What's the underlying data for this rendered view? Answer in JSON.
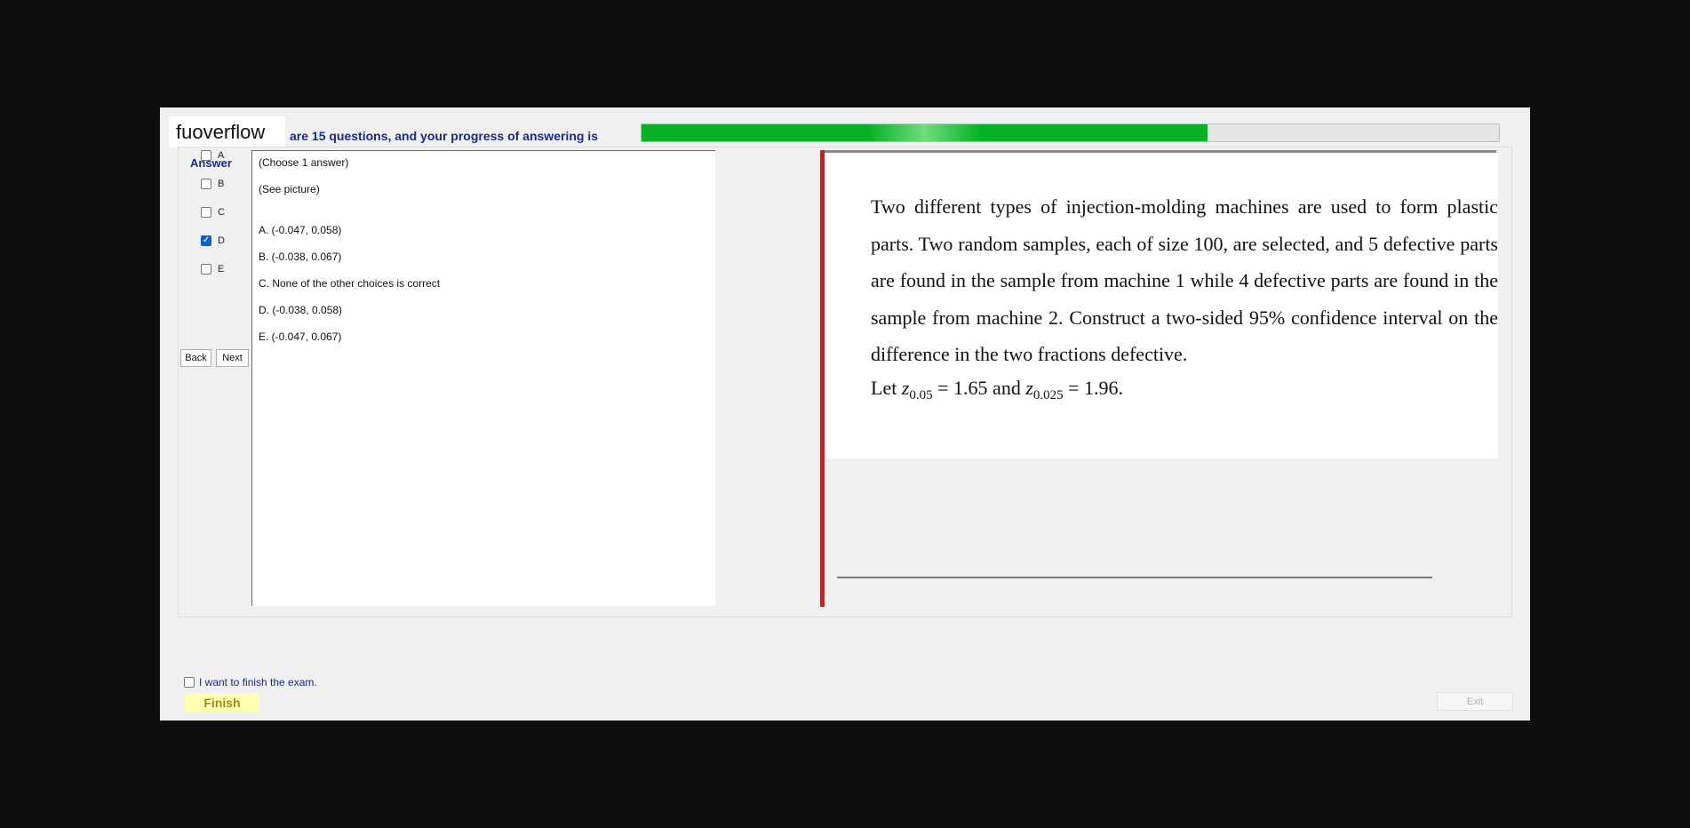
{
  "brand": {
    "logo_text": "fuoverflow"
  },
  "progress": {
    "text": "are 15 questions, and your progress of answering is",
    "fraction": 0.66
  },
  "answer_panel": {
    "heading": "Answer",
    "options": [
      {
        "label": "A",
        "checked": false
      },
      {
        "label": "B",
        "checked": false
      },
      {
        "label": "C",
        "checked": false
      },
      {
        "label": "D",
        "checked": true
      },
      {
        "label": "E",
        "checked": false
      }
    ],
    "back_label": "Back",
    "next_label": "Next"
  },
  "question": {
    "instruction": "(Choose 1 answer)",
    "see_picture": "(See picture)",
    "choices": [
      "A.  (-0.047, 0.058)",
      "B.  (-0.038, 0.067)",
      "C.  None of the other choices is correct",
      "D.  (-0.038, 0.058)",
      "E.  (-0.047, 0.067)"
    ]
  },
  "picture": {
    "problem_text": "Two different types of injection-molding machines are used to form plastic parts. Two random samples, each of size 100, are selected, and 5 defective parts are found in the sample from machine 1 while 4 defective parts are found in the sample from machine 2. Construct a two-sided 95% confidence interval on the difference in the two fractions defective.",
    "let": "Let",
    "z_var": "z",
    "z1_sub": "0.05",
    "eq1": " = 1.65 and ",
    "z2_sub": "0.025",
    "eq2": " = 1.96."
  },
  "footer": {
    "finish_checkbox_label": "I want to finish the exam.",
    "finish_label": "Finish",
    "exit_label": "Exit"
  },
  "colors": {
    "progress_green": "#06b025",
    "heading_blue": "#1a2a8a",
    "divider_red": "#d41a1a",
    "finish_yellow": "#ffffb0"
  }
}
